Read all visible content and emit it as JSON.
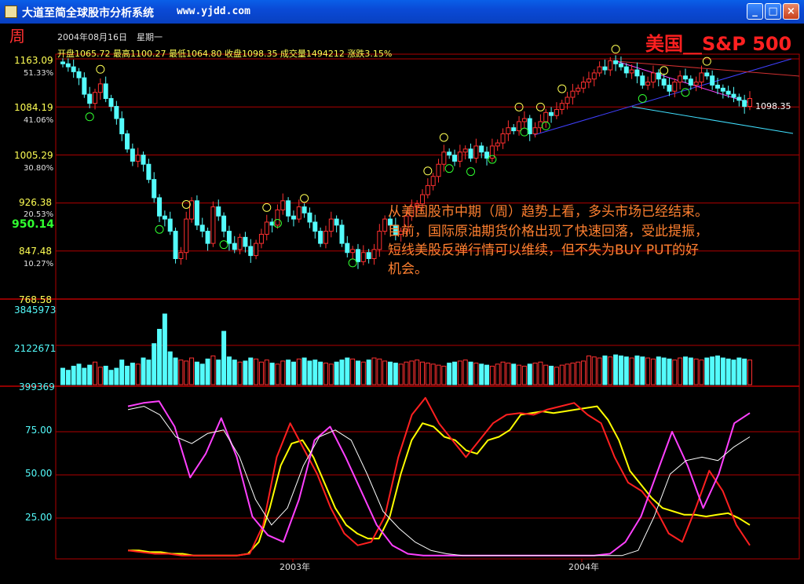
{
  "window": {
    "title": "大道至简全球股市分析系统",
    "url": "www.yjdd.com",
    "buttons": {
      "minimize": "_",
      "maximize": "□",
      "close": "×"
    }
  },
  "header": {
    "period": "周",
    "date": "2004年08月16日",
    "weekday": "星期一",
    "quote": "开盘1065.72 最高1100.27 最低1064.80 收盘1098.35 成交量1494212 涨跌3.15%",
    "index_name": "美国__S&P 500",
    "cursor_value": "950.14",
    "last_price": "1098.35"
  },
  "colors": {
    "up": "#ff3030",
    "down": "#54fcfc",
    "grid": "#b00000",
    "label": "#ffff54",
    "commentary": "#ff8030"
  },
  "axis": {
    "price_ticks": [
      {
        "price": "1163.09",
        "pct": "51.33%"
      },
      {
        "price": "1084.19",
        "pct": "41.06%"
      },
      {
        "price": "1005.29",
        "pct": "30.80%"
      },
      {
        "price": "926.38",
        "pct": "20.53%"
      },
      {
        "price": "847.48",
        "pct": "10.27%"
      },
      {
        "price": "768.58",
        "pct": ""
      }
    ],
    "volume_ticks": [
      "3845973",
      "2122671",
      "399369"
    ],
    "osc_ticks": [
      "75.00",
      "50.00",
      "25.00"
    ],
    "time_labels": [
      "2003年",
      "2004年"
    ]
  },
  "commentary": [
    "从美国股市中期（周）趋势上看，多头市场已经结束。",
    "目前，国际原油期货价格出现了快速回落，受此提振，",
    "短线美股反弹行情可以维续，但不失为BUY PUT的好",
    "机会。"
  ],
  "chart_data": {
    "type": "candlestick",
    "price_range": [
      768.58,
      1163.09
    ],
    "volume_range": [
      399369,
      3845973
    ],
    "oscillator_range": [
      0,
      100
    ],
    "close": [
      1155,
      1150,
      1142,
      1132,
      1105,
      1090,
      1108,
      1122,
      1098,
      1085,
      1065,
      1040,
      1015,
      995,
      1005,
      990,
      965,
      935,
      905,
      900,
      880,
      835,
      845,
      900,
      930,
      890,
      880,
      860,
      920,
      905,
      880,
      860,
      850,
      870,
      855,
      840,
      860,
      875,
      895,
      890,
      915,
      930,
      905,
      900,
      920,
      910,
      895,
      880,
      860,
      880,
      900,
      890,
      860,
      845,
      850,
      830,
      845,
      835,
      850,
      880,
      900,
      890,
      875,
      880,
      905,
      920,
      925,
      940,
      955,
      970,
      990,
      1010,
      1005,
      995,
      1010,
      1015,
      1000,
      1020,
      1010,
      1000,
      1020,
      1025,
      1040,
      1050,
      1045,
      1060,
      1065,
      1040,
      1050,
      1060,
      1075,
      1070,
      1080,
      1090,
      1100,
      1110,
      1115,
      1125,
      1130,
      1140,
      1150,
      1145,
      1160,
      1155,
      1150,
      1140,
      1145,
      1135,
      1120,
      1125,
      1140,
      1130,
      1120,
      1110,
      1125,
      1135,
      1130,
      1120,
      1125,
      1140,
      1135,
      1120,
      1115,
      1110,
      1105,
      1100,
      1095,
      1085,
      1098
    ],
    "volume": [
      1200000,
      1100000,
      1300000,
      1400000,
      1200000,
      1350000,
      1500000,
      1250000,
      1300000,
      1100000,
      1200000,
      1600000,
      1300000,
      1450000,
      1400000,
      1700000,
      1600000,
      2400000,
      3100000,
      3845973,
      2000000,
      1700000,
      1600000,
      1550000,
      1700000,
      1500000,
      1400000,
      1650000,
      1800000,
      1600000,
      3000000,
      1750000,
      1600000,
      1500000,
      1550000,
      1700000,
      1650000,
      1500000,
      1600000,
      1450000,
      1400000,
      1550000,
      1600000,
      1500000,
      1650000,
      1700000,
      1550000,
      1600000,
      1500000,
      1450000,
      1400000,
      1500000,
      1600000,
      1700000,
      1650000,
      1550000,
      1500000,
      1600000,
      1700000,
      1650000,
      1550000,
      1500000,
      1450000,
      1400000,
      1500000,
      1550000,
      1600000,
      1500000,
      1450000,
      1400000,
      1350000,
      1300000,
      1450000,
      1500000,
      1550000,
      1600000,
      1500000,
      1450000,
      1400000,
      1350000,
      1300000,
      1400000,
      1500000,
      1450000,
      1400000,
      1350000,
      1300000,
      1400000,
      1450000,
      1500000,
      1350000,
      1300000,
      1250000,
      1350000,
      1400000,
      1450000,
      1500000,
      1550000,
      1800000,
      1750000,
      1700000,
      1800000,
      1750000,
      1850000,
      1800000,
      1750000,
      1700000,
      1800000,
      1750000,
      1700000,
      1650000,
      1750000,
      1700000,
      1650000,
      1600000,
      1700000,
      1750000,
      1700000,
      1650000,
      1600000,
      1700000,
      1750000,
      1800000,
      1700000,
      1650000,
      1600000,
      1700000,
      1650000,
      1600000,
      1494212
    ],
    "series": [
      {
        "name": "",
        "color": "#ffff00",
        "points": [
          5,
          5,
          4,
          4,
          3,
          3,
          2,
          2,
          2,
          2,
          2,
          3,
          10,
          30,
          55,
          68,
          70,
          60,
          45,
          30,
          20,
          15,
          12,
          12,
          25,
          50,
          70,
          80,
          78,
          72,
          70,
          64,
          62,
          70,
          72,
          76,
          85,
          86,
          87,
          86,
          87,
          88,
          89,
          90,
          82,
          70,
          52,
          44,
          36,
          30,
          28,
          26,
          26,
          25,
          26,
          27,
          24,
          20
        ]
      },
      {
        "name": "",
        "color": "#ff2020",
        "points": [
          5,
          4,
          3,
          3,
          2,
          2,
          2,
          2,
          2,
          3,
          20,
          60,
          80,
          65,
          50,
          30,
          15,
          8,
          10,
          25,
          60,
          85,
          95,
          80,
          70,
          60,
          70,
          80,
          85,
          86,
          85,
          88,
          90,
          92,
          85,
          80,
          60,
          45,
          40,
          30,
          15,
          10,
          30,
          52,
          40,
          20,
          8
        ]
      },
      {
        "name": "",
        "color": "#ff40ff",
        "points": [
          90,
          92,
          93,
          78,
          48,
          62,
          83,
          60,
          25,
          14,
          10,
          35,
          70,
          78,
          60,
          40,
          20,
          8,
          3,
          2,
          2,
          2,
          2,
          2,
          2,
          2,
          2,
          2,
          2,
          2,
          2,
          3,
          10,
          25,
          50,
          75,
          55,
          30,
          50,
          80,
          86
        ]
      },
      {
        "name": "",
        "color": "#ffffff",
        "points": [
          88,
          90,
          85,
          72,
          68,
          74,
          76,
          60,
          35,
          20,
          30,
          55,
          72,
          76,
          70,
          50,
          28,
          18,
          10,
          5,
          3,
          2,
          2,
          2,
          2,
          2,
          2,
          2,
          2,
          2,
          2,
          2,
          5,
          25,
          50,
          58,
          60,
          58,
          66,
          72
        ]
      }
    ]
  }
}
